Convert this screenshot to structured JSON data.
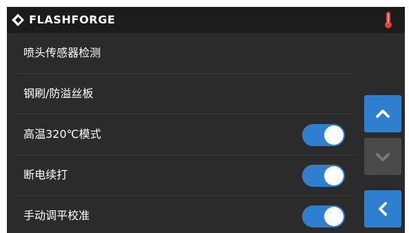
{
  "header": {
    "brand": "FLASHFORGE",
    "logo_icon": "flashforge-logo-icon",
    "status_icon": "thermometer-icon",
    "status_color": "#e0433b"
  },
  "settings": {
    "items": [
      {
        "label": "喷头传感器检测",
        "has_toggle": false
      },
      {
        "label": "钢刷/防溢丝板",
        "has_toggle": false
      },
      {
        "label": "高温320℃模式",
        "has_toggle": true,
        "enabled": true
      },
      {
        "label": "断电续打",
        "has_toggle": true,
        "enabled": true
      },
      {
        "label": "手动调平校准",
        "has_toggle": true,
        "enabled": true
      }
    ]
  },
  "navigation": {
    "scroll_up_icon": "chevron-up-icon",
    "scroll_down_icon": "chevron-down-icon",
    "back_icon": "chevron-left-icon",
    "scroll_up_enabled": true,
    "scroll_down_enabled": false
  },
  "colors": {
    "accent": "#2f7fd0",
    "background": "#2b2b2b",
    "topbar": "#1c1c1c",
    "disabled": "#4a4a4a"
  }
}
